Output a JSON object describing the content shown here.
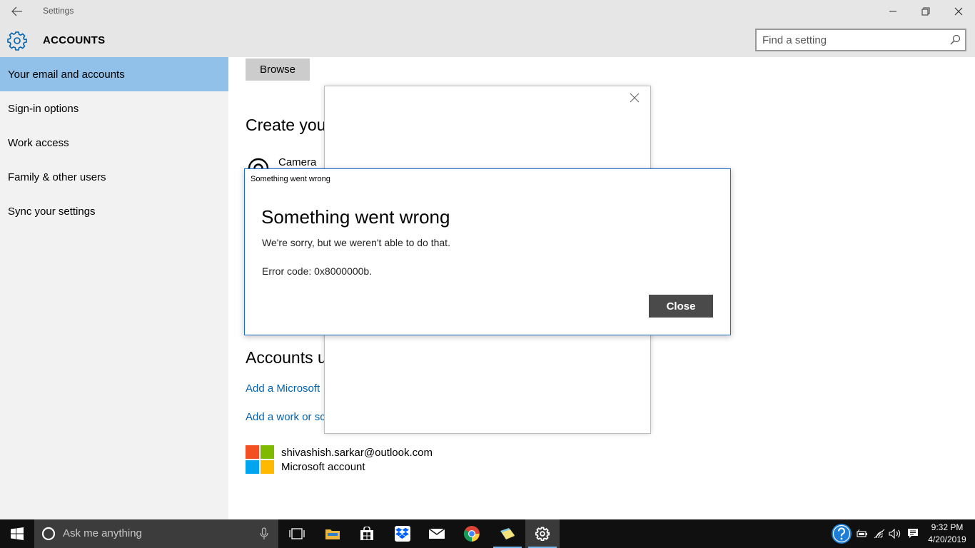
{
  "window": {
    "title": "Settings",
    "controls": {
      "minimize": "minimize-icon",
      "restore": "restore-icon",
      "close": "close-icon"
    }
  },
  "header": {
    "section_title": "ACCOUNTS",
    "icon": "gear-icon",
    "search": {
      "placeholder": "Find a setting",
      "value": ""
    }
  },
  "sidebar": {
    "items": [
      {
        "label": "Your email and accounts",
        "selected": true
      },
      {
        "label": "Sign-in options",
        "selected": false
      },
      {
        "label": "Work access",
        "selected": false
      },
      {
        "label": "Family & other users",
        "selected": false
      },
      {
        "label": "Sync your settings",
        "selected": false
      }
    ]
  },
  "content": {
    "browse_label": "Browse",
    "create_heading": "Create you",
    "camera_label": "Camera",
    "accounts_heading": "Accounts u",
    "links": {
      "add_microsoft": "Add a Microsoft",
      "add_work": "Add a work or sc"
    },
    "account": {
      "email": "shivashish.sarkar@outlook.com",
      "type": "Microsoft account"
    },
    "logo_colors": [
      "#f25022",
      "#7fba00",
      "#00a4ef",
      "#ffb900"
    ]
  },
  "error_dialog": {
    "caption": "Something went wrong",
    "title": "Something went wrong",
    "message": "We're sorry, but we weren't able to do that.",
    "error_code": "Error code: 0x8000000b.",
    "close_label": "Close"
  },
  "taskbar": {
    "search_placeholder": "Ask me anything",
    "pinned_apps": [
      "task-view-icon",
      "file-explorer-icon",
      "store-icon",
      "dropbox-icon",
      "mail-icon",
      "chrome-icon",
      "sticky-notes-icon",
      "settings-icon"
    ],
    "tray_icons": [
      "help-icon",
      "battery-icon",
      "wifi-icon",
      "volume-icon",
      "action-center-icon"
    ],
    "clock": {
      "time": "9:32 PM",
      "date": "4/20/2019"
    }
  },
  "colors": {
    "accent": "#0063b1",
    "selection": "#91c0e8",
    "dialog_border": "#1f6fc4",
    "close_button": "#4a4a4a",
    "taskbar": "#101010"
  }
}
